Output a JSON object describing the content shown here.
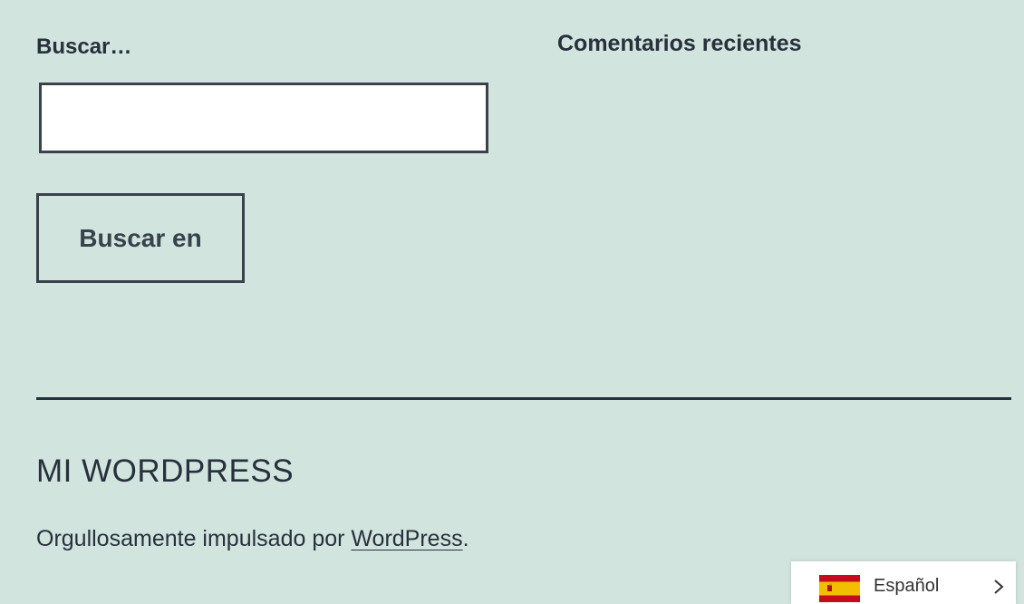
{
  "search": {
    "label": "Buscar…",
    "input_value": "",
    "button_label": "Buscar en"
  },
  "recent_comments": {
    "title": "Comentarios recientes"
  },
  "footer": {
    "site_title": "MI WORDPRESS",
    "powered_by_prefix": "Orgullosamente impulsado por ",
    "powered_by_link": "WordPress",
    "powered_by_suffix": "."
  },
  "language_switcher": {
    "label": "Español",
    "flag_icon": "spain-flag-icon",
    "arrow_icon": "chevron-right-icon"
  },
  "colors": {
    "background": "#d1e4dd",
    "text": "#28303d",
    "border": "#39414d",
    "flag_red": "#c60b1e",
    "flag_yellow": "#f1bf00"
  }
}
